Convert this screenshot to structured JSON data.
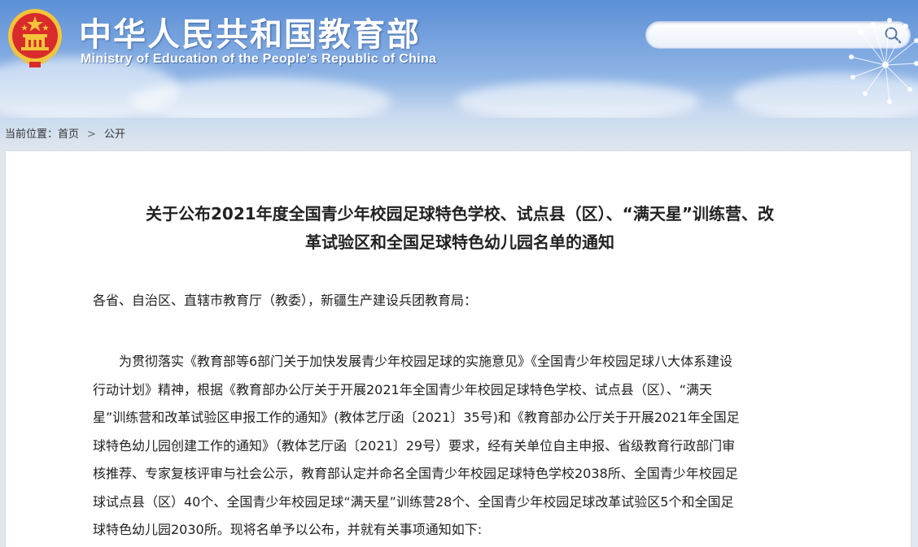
{
  "header": {
    "title": "中华人民共和国教育部",
    "subtitle": "Ministry of Education of the People's Republic of China",
    "search": {
      "placeholder": "",
      "button_icon": "search-icon"
    }
  },
  "breadcrumb": {
    "label": "当前位置：",
    "items": [
      "首页",
      "公开"
    ],
    "separator": ">"
  },
  "article": {
    "title_lines": [
      "关于公布2021年度全国青少年校园足球特色学校、试点县（区）、“满天星”训练营、改",
      "革试验区和全国足球特色幼儿园名单的通知"
    ],
    "salutation": "各省、自治区、直辖市教育厅（教委），新疆生产建设兵团教育局：",
    "paragraph_lines": [
      "为贯彻落实《教育部等6部门关于加快发展青少年校园足球的实施意见》《全国青少年校园足球八大体系建设",
      "行动计划》精神，根据《教育部办公厅关于开展2021年全国青少年校园足球特色学校、试点县（区）、“满天",
      "星”训练营和改革试验区申报工作的通知》(教体艺厅函〔2021〕35号)和《教育部办公厅关于开展2021年全国足",
      "球特色幼儿园创建工作的通知》（教体艺厅函〔2021〕29号）要求，经有关单位自主申报、省级教育行政部门审",
      "核推荐、专家复核评审与社会公示，教育部认定并命名全国青少年校园足球特色学校2038所、全国青少年校园足",
      "球试点县（区）40个、全国青少年校园足球“满天星”训练营28个、全国青少年校园足球改革试验区5个和全国足",
      "球特色幼儿园2030所。现将名单予以公布，并就有关事项通知如下:"
    ]
  },
  "colors": {
    "header_blue": "#5c8fd6",
    "emblem_red": "#d92b2b",
    "emblem_gold": "#f3c53a",
    "text": "#222222"
  }
}
